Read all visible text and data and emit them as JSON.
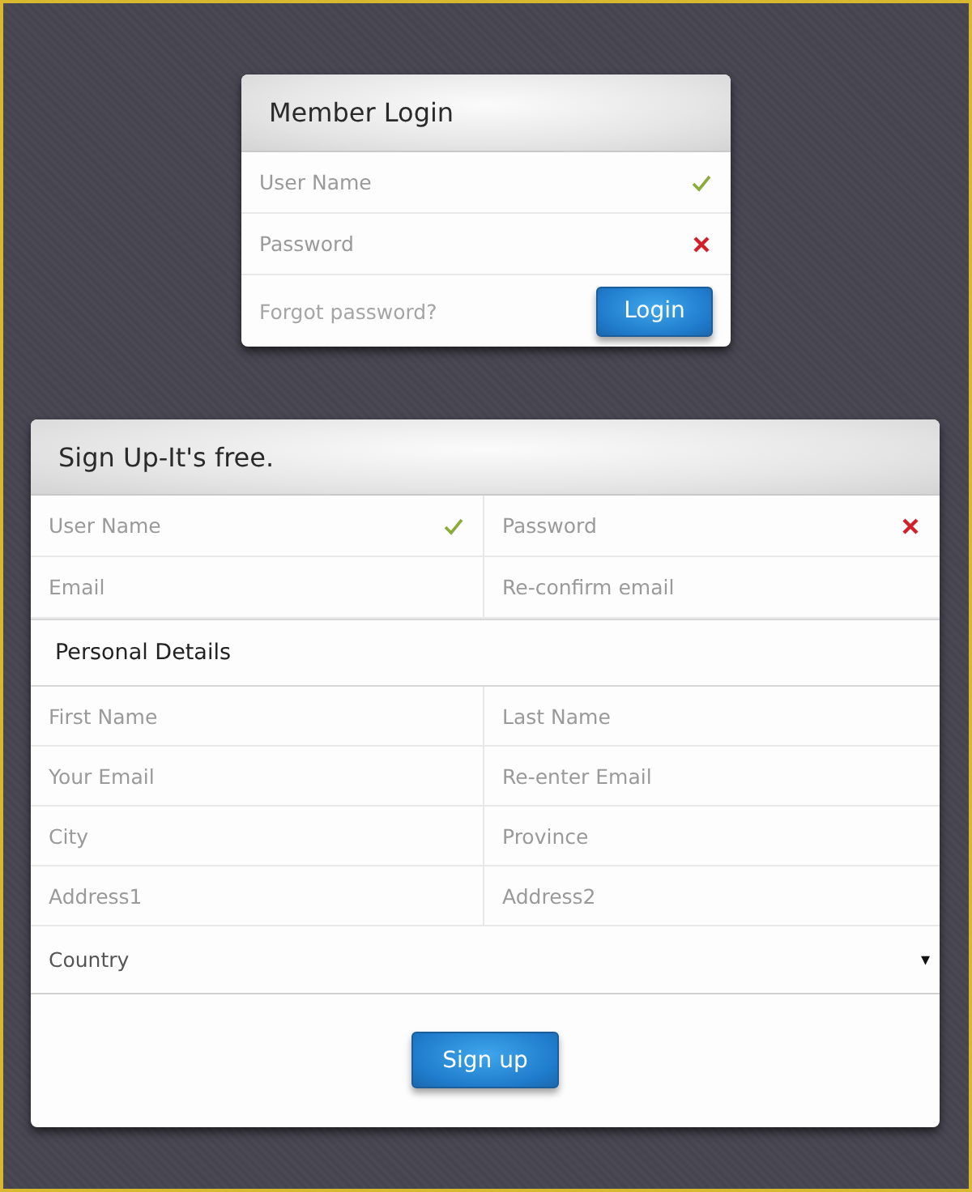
{
  "login": {
    "title": "Member Login",
    "fields": [
      {
        "placeholder": "User Name",
        "valid": true
      },
      {
        "placeholder": "Password",
        "valid": false
      }
    ],
    "forgot_link": "Forgot password?",
    "button": "Login"
  },
  "signup": {
    "title": "Sign Up-It's free.",
    "account_fields": [
      {
        "placeholder": "User Name",
        "valid": true
      },
      {
        "placeholder": "Password",
        "valid": false
      },
      {
        "placeholder": "Email"
      },
      {
        "placeholder": "Re-confirm email"
      }
    ],
    "section_title": "Personal Details",
    "personal_fields": [
      {
        "placeholder": "First Name"
      },
      {
        "placeholder": "Last Name"
      },
      {
        "placeholder": "Your Email"
      },
      {
        "placeholder": "Re-enter Email"
      },
      {
        "placeholder": "City"
      },
      {
        "placeholder": "Province"
      },
      {
        "placeholder": "Address1"
      },
      {
        "placeholder": "Address2"
      }
    ],
    "country": {
      "label": "Country",
      "caret": "▾"
    },
    "button": "Sign up"
  }
}
